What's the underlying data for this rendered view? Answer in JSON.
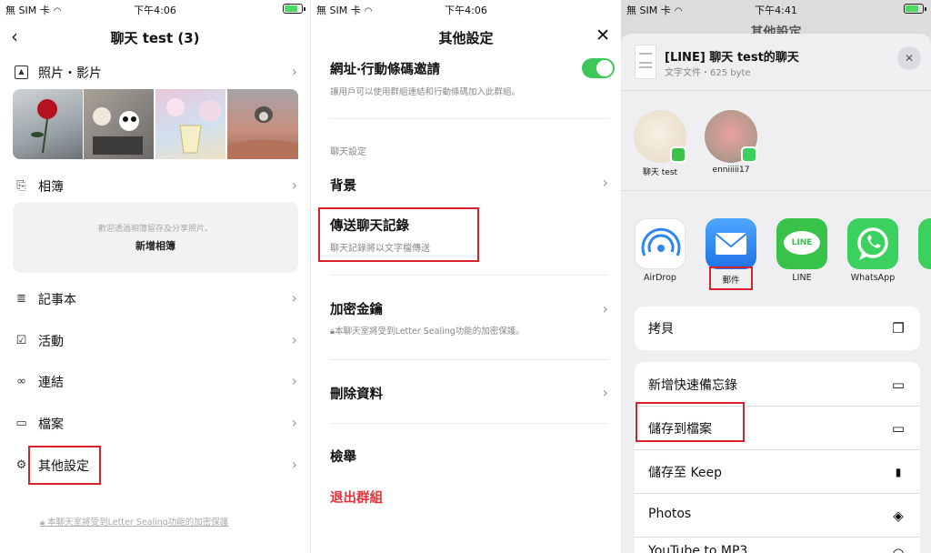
{
  "panel1": {
    "status": {
      "carrier": "無 SIM 卡",
      "time": "下午4:06"
    },
    "header": {
      "title": "聊天 test (3)"
    },
    "photos": {
      "label": "照片・影片"
    },
    "album": {
      "label": "相簿",
      "empty_text": "歡迎透過相簿留存及分享照片。",
      "new_label": "新增相簿"
    },
    "menu": [
      {
        "label": "記事本"
      },
      {
        "label": "活動"
      },
      {
        "label": "連結"
      },
      {
        "label": "檔案"
      },
      {
        "label": "其他設定"
      }
    ],
    "footer": "本聊天室將受到Letter Sealing功能的加密保護"
  },
  "panel2": {
    "status": {
      "carrier": "無 SIM 卡",
      "time": "下午4:06"
    },
    "header": {
      "title": "其他設定"
    },
    "invite": {
      "title": "網址‧行動條碼邀請",
      "desc": "讓用戶可以使用群組連結和行動條碼加入此群組。"
    },
    "section_label": "聊天設定",
    "background": "背景",
    "send_history": {
      "title": "傳送聊天記錄",
      "desc": "聊天記錄將以文字檔傳送"
    },
    "encryption": {
      "title": "加密金鑰",
      "desc": "本聊天室將受到Letter Sealing功能的加密保護。"
    },
    "delete_data": "刪除資料",
    "report": "檢舉",
    "leave_group": "退出群組",
    "colors": {
      "danger": "#e5323b",
      "toggle": "#3ec75b"
    }
  },
  "panel3": {
    "status": {
      "carrier": "無 SIM 卡",
      "time": "下午4:41"
    },
    "behind_title": "其他設定",
    "file": {
      "name": "[LINE] 聊天 test的聊天",
      "meta": "文字文件・625 byte"
    },
    "contacts": [
      {
        "name": "聊天 test"
      },
      {
        "name": "enniiiii17"
      }
    ],
    "apps": [
      {
        "name": "AirDrop",
        "icon": "airdrop-icon"
      },
      {
        "name": "郵件",
        "icon": "mail-icon"
      },
      {
        "name": "LINE",
        "icon": "line-icon",
        "text": "LINE"
      },
      {
        "name": "WhatsApp",
        "icon": "whatsapp-icon"
      }
    ],
    "actions": [
      {
        "label": "拷貝",
        "icon": "copy-icon"
      },
      {
        "label": "新增快速備忘錄",
        "icon": "quick-note-icon"
      },
      {
        "label": "儲存到檔案",
        "icon": "folder-icon"
      },
      {
        "label": "儲存至 Keep",
        "icon": "bookmark-icon"
      },
      {
        "label": "Photos",
        "icon": "layers-icon"
      },
      {
        "label": "YouTube to MP3",
        "icon": "headphones-icon"
      }
    ],
    "colors": {
      "line": "#39c24a",
      "whatsapp": "#3bd15e",
      "mail": "#2f86f0"
    }
  }
}
